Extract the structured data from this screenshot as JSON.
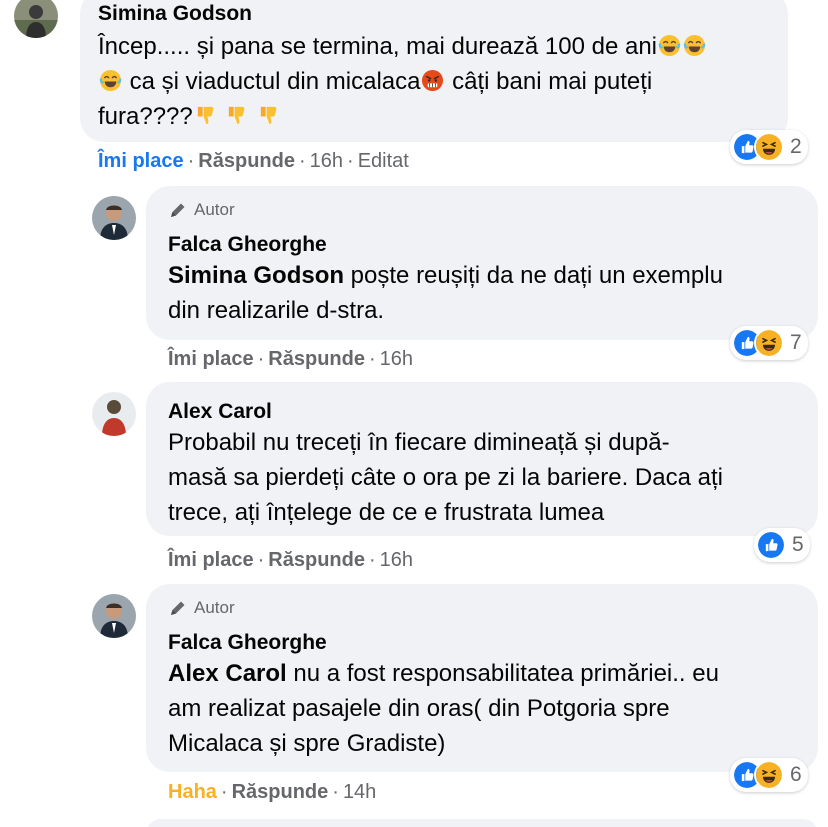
{
  "comments": [
    {
      "author": "Simina Godson",
      "lines": [
        "Încep..... și pana se termina, mai durează 100 de ani",
        " ca și viaductul din micalaca",
        " câți bani mai puteți",
        "fura????"
      ],
      "actions": {
        "like": "Îmi place",
        "reply": "Răspunde",
        "time": "16h",
        "edited": "Editat"
      },
      "reaction_count": "2"
    },
    {
      "badge": "Autor",
      "author": "Falca Gheorghe",
      "mention": "Simina Godson",
      "lines": [
        " poște reușiți da ne dați un exemplu",
        "din realizarile d-stra."
      ],
      "actions": {
        "like": "Îmi place",
        "reply": "Răspunde",
        "time": "16h"
      },
      "reaction_count": "7"
    },
    {
      "author": "Alex Carol",
      "lines": [
        "Probabil nu treceți în fiecare dimineață și după-",
        "masă sa pierdeți câte o ora pe zi la bariere. Daca ați",
        "trece, ați înțelege de ce e frustrata lumea"
      ],
      "actions": {
        "like": "Îmi place",
        "reply": "Răspunde",
        "time": "16h"
      },
      "reaction_count": "5"
    },
    {
      "badge": "Autor",
      "author": "Falca Gheorghe",
      "mention": "Alex Carol",
      "lines": [
        " nu a fost responsabilitatea primăriei.. eu",
        "am realizat pasajele din oras( din Potgoria spre",
        "Micalaca și spre Gradiste)"
      ],
      "actions": {
        "like": "Haha",
        "reply": "Răspunde",
        "time": "14h"
      },
      "reaction_count": "6"
    }
  ],
  "separator": "·",
  "icons": {
    "like": "like-reaction-icon",
    "haha": "haha-reaction-icon",
    "joy": "laughing-tears-emoji-icon",
    "angry": "angry-face-emoji-icon",
    "thumbs_down": "thumbs-down-emoji-icon",
    "badge": "pen-icon"
  },
  "colors": {
    "bubble": "#f0f2f5",
    "like_blue": "#1877f2",
    "haha_yellow": "#f7b125",
    "meta_gray": "#65676b"
  }
}
